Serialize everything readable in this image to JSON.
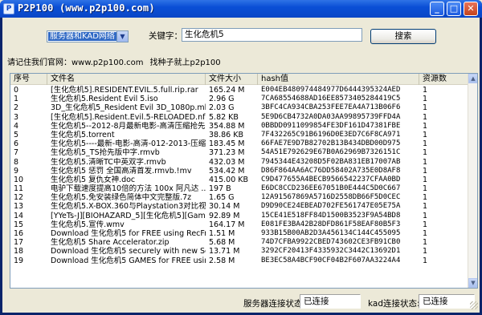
{
  "window": {
    "title": "P2P100  (www.p2p100.com)"
  },
  "search": {
    "source_select": "服务器和KAD网络",
    "keyword_label": "关键字：",
    "keyword_value": "生化危机5",
    "search_button": "搜索"
  },
  "info": {
    "site_text": "请记住我们官网：www.p2p100.com",
    "slogan": "找种子就上p2p100"
  },
  "table": {
    "columns": [
      "序号",
      "文件名",
      "文件大小",
      "hash值",
      "资源数"
    ],
    "rows": [
      [
        "0",
        "[生化危机5].RESIDENT.EVIL.5.full.rip.rar",
        "165.24 M",
        "E004EB480974484977D6444395324AED",
        "1"
      ],
      [
        "1",
        "生化危机5.Resident Evil 5.iso",
        "2.96 G",
        "7CA68554688AD16EE8573405284419C5",
        "1"
      ],
      [
        "2",
        "3D_生化危机5_Resident Evil 3D_1080p.mkv",
        "2.03 G",
        "3BFC4CA934CBA253FEE7EA4A713B06F6",
        "1"
      ],
      [
        "3",
        "[生化危机5].Resident.Evil.5-RELOADED.nfo",
        "5.82 KB",
        "5E9D6CB4732A0DA03AA99895739FFD4A",
        "1"
      ],
      [
        "4",
        "生化危机5--2012-8月最新电影-高清压缩抢先...",
        "354.88 M",
        "0BBDD0911099854FE3DF161D47381FBE",
        "1"
      ],
      [
        "5",
        "生化危机5.torrent",
        "38.86 KB",
        "7F432265C91B6196D0E3ED7C6F8CA971",
        "1"
      ],
      [
        "6",
        "生化危机5----最新-电影-高清-012-2013-压缩-...",
        "183.45 M",
        "66FAE7E9D7B82702B13B434DBD00D975",
        "1"
      ],
      [
        "7",
        "生化危机5_TS抢先版中字.rmvb",
        "371.23 M",
        "54A51E792629E67B0A62969B7326151C",
        "1"
      ],
      [
        "8",
        "生化危机5.清晰TC中英双字.rmvb",
        "432.03 M",
        "7945344E43208D5F02BA831EB17007AB",
        "1"
      ],
      [
        "9",
        "生化危机5 惩罚 全国高清首发.rmvb.!mv",
        "534.42 M",
        "D86F864AA6AC76DD58402A735E0D8AF8",
        "1"
      ],
      [
        "10",
        "生化危机5 复仇女神.doc",
        "415.00 KB",
        "C9D477655A4BECB9566542237CFAA0BD",
        "1"
      ],
      [
        "11",
        "电驴下载速度提高10倍的方法 100x  阿凡达 ...",
        "197 B",
        "E6DC8CCD236EE67051B0E444C5D0C667",
        "1"
      ],
      [
        "12",
        "生化危机5.免安装绿色简体中文完整版.7z",
        "1.65 G",
        "12A91567869A5716D2558DB66F5D0CEC",
        "1"
      ],
      [
        "13",
        "生化危机5.X-BOX.360与Playstation3对比视频...",
        "30.14 M",
        "D9D90CE24EBEAD702FE561747E05E75A",
        "1"
      ],
      [
        "14",
        "[YYeTs-J][BIOHAZARD_5][生化危机5][Game...",
        "92.89 M",
        "15CE41E518FF84D1500B3523F9A54BD8",
        "1"
      ],
      [
        "15",
        "生化危机5.宣传.wmv",
        "164.17 M",
        "E081FE3BA42B28DFD861F58EAF80B5F3",
        "1"
      ],
      [
        "16",
        "Download 生化危机5 for FREE using RecFree...",
        "1.51 M",
        "933B15B00AB2D3A456134C144C455095",
        "1"
      ],
      [
        "17",
        "生化危机5 Share Accelerator.zip",
        "5.68 M",
        "74D7CFBA9922CBED743602CE3FB91CB0",
        "1"
      ],
      [
        "18",
        "Download 生化危机5 securely with new Sec...",
        "13.71 M",
        "3292CF20413F4335932C3442C13692D1",
        "1"
      ],
      [
        "19",
        "Download 生化危机5 GAMES for FREE using ...",
        "2.58 M",
        "BE3EC58A4BCF90CF04B2F607AA3224A4",
        "1"
      ]
    ]
  },
  "status": {
    "server_label": "服务器连接状态:",
    "server_value": "已连接",
    "kad_label": "kad连接状态:",
    "kad_value": "已连接"
  }
}
